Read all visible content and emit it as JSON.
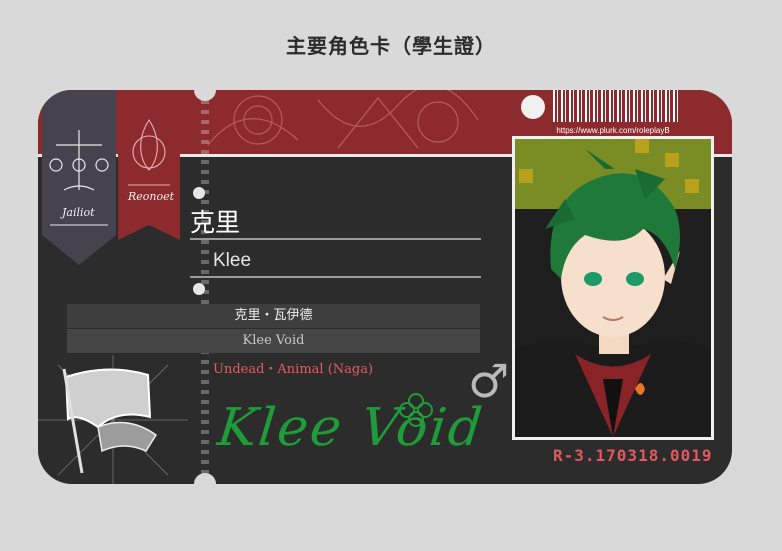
{
  "page": {
    "title": "主要角色卡（學生證）"
  },
  "card": {
    "url": "https://www.plurk.com/roleplayB",
    "ribbons": {
      "left_label": "Jailiot",
      "right_label": "Reonoet"
    },
    "name_cn": "克里",
    "name_en": "Klee",
    "full_name_cn": "克里・瓦伊德",
    "full_name_en": "Klee Void",
    "race": "Undead・Animal (Naga)",
    "gender_symbol": "♂",
    "signature": "Klee Void",
    "serial": "R-3.170318.0019"
  },
  "colors": {
    "band_red": "#8d2a2d",
    "card_dark": "#2c2c2c",
    "accent_red": "#e2585f",
    "signature_green": "#1f9c3a"
  }
}
